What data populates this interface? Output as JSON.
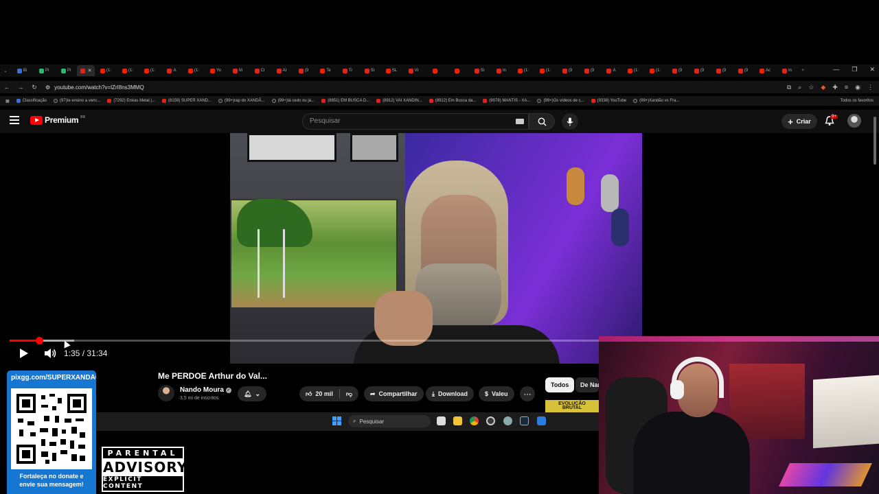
{
  "browser": {
    "url": "youtube.com/watch?v=lZrI8ns3MMQ",
    "tabs": [
      "Bi",
      "Pi",
      "Pi",
      "",
      "(1:",
      "(1:",
      "(1:",
      "A",
      "(1:",
      "Yo",
      "M",
      "Cl",
      "AI",
      "(9",
      "Te",
      "Tr",
      "St",
      "SL",
      "VI",
      "",
      "",
      "St",
      "In",
      "(1:",
      "(1:",
      "(9",
      "(9",
      "A",
      "(1:",
      "(1:",
      "(9",
      "(9",
      "(9",
      "(9",
      "Ac",
      "In"
    ],
    "bookmarks": [
      "Classificação",
      "(97)Ie ensino a venc...",
      "(7292) Enéas Metal |...",
      "(8159) SUPER XAND...",
      "(99+)rap do XANDÃ...",
      "(99+)tá cedo ou já...",
      "(8851) EM BUSCA D...",
      "(8912) VAI XANDIN...",
      "(8912) Em Busca da...",
      "(9078) MANTIS - XA...",
      "(99+)Os vídeos de c...",
      "(9338) YouTube",
      "(99+)Xandão vs Fra..."
    ],
    "all_bookmarks": "Todos os favoritos"
  },
  "youtube": {
    "logo_text": "Premium",
    "logo_region": "BR",
    "search_placeholder": "Pesquisar",
    "create_label": "Criar",
    "notif_badge": "9+"
  },
  "player": {
    "time": "1:35 / 31:34",
    "progress_fraction": 0.0502,
    "buffer_fraction": 0.109
  },
  "video": {
    "title": "Me PERDOE Arthur do Val...",
    "channel": "Nando Moura",
    "subscribers": "3,5 mi de inscritos",
    "likes": "20 mil",
    "share_label": "Compartilhar",
    "download_label": "Download",
    "valeu_label": "Valeu"
  },
  "sidebar": {
    "chip_all": "Todos",
    "chip_second": "De Nando Moura",
    "thumb_text_1": "EVOLUÇÃO",
    "thumb_text_2": "BRUTAL"
  },
  "taskbar": {
    "search_placeholder": "Pesquisar"
  },
  "overlay": {
    "pix_url": "pixgg.com/SUPERXANDÃO",
    "pix_message_1": "Fortaleça no donate e",
    "pix_message_2": "envie sua mensagem!",
    "advisory_top": "PARENTAL",
    "advisory_mid": "ADVISORY",
    "advisory_bot": "EXPLICIT CONTENT"
  },
  "colors": {
    "accent": "#ff0000",
    "pix_blue": "#1677d2"
  }
}
